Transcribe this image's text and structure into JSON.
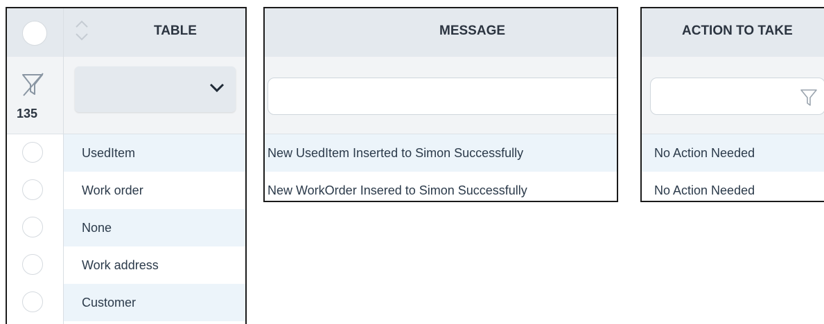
{
  "table_panel": {
    "header_label": "TABLE",
    "filter_count": "135",
    "rows": [
      "UsedItem",
      "Work order",
      "None",
      "Work address",
      "Customer"
    ]
  },
  "message_panel": {
    "header_label": "MESSAGE",
    "rows": [
      "New UsedItem Inserted to Simon Successfully",
      "New WorkOrder Insered to Simon Successfully"
    ]
  },
  "action_panel": {
    "header_label": "ACTION TO TAKE",
    "rows": [
      "No Action Needed",
      "No Action Needed"
    ]
  },
  "colors": {
    "header_bg": "#e4e9ee",
    "row_alt_bg": "#ecf4fa",
    "border": "#1a1a1a"
  }
}
